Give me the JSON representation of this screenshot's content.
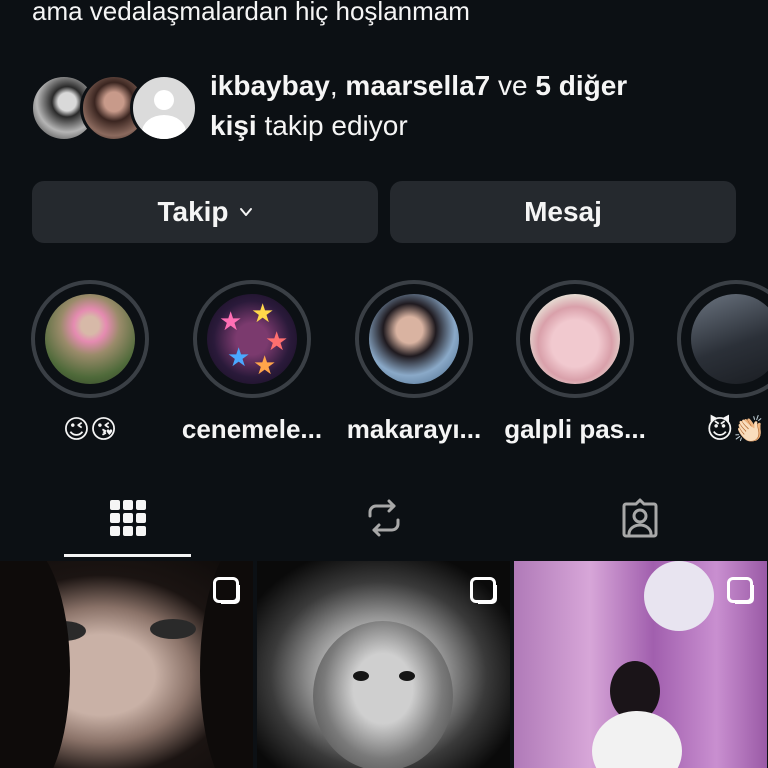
{
  "profile": {
    "bio_line": "ama vedalaşmalardan hiç hoşlanmam"
  },
  "followed_by": {
    "user1": "ikbaybay",
    "sep1": ", ",
    "user2": "maarsella7",
    "middle": " ve ",
    "others_bold_1": "5 diğer",
    "others_bold_2": "kişi",
    "suffix": " takip ediyor"
  },
  "actions": {
    "follow_label": "Takip",
    "message_label": "Mesaj"
  },
  "highlights": [
    {
      "label": "😉😘"
    },
    {
      "label": "cenemele..."
    },
    {
      "label": "makarayı..."
    },
    {
      "label": "galpli pas..."
    },
    {
      "label": "😈👏🏻"
    }
  ],
  "tabs": [
    {
      "icon": "grid-icon",
      "selected": true
    },
    {
      "icon": "reposts-icon",
      "selected": false
    },
    {
      "icon": "tagged-icon",
      "selected": false
    }
  ],
  "colors": {
    "background": "#0c1014",
    "button_bg": "#25292e",
    "text": "#f5f5f5",
    "ring": "#3a3f45"
  }
}
